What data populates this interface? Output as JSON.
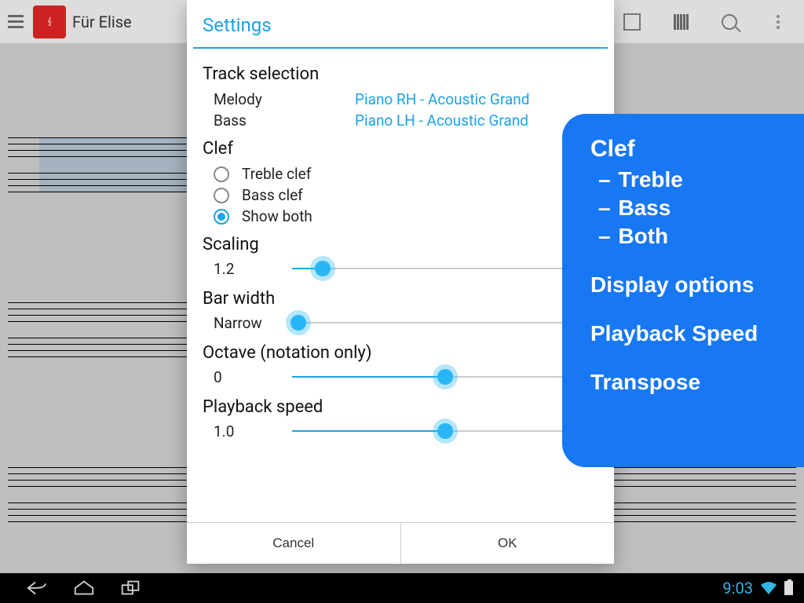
{
  "topbar": {
    "title": "Für Elise"
  },
  "dialog": {
    "title": "Settings",
    "track_selection": {
      "heading": "Track selection",
      "melody_label": "Melody",
      "melody_value": "Piano RH - Acoustic Grand",
      "bass_label": "Bass",
      "bass_value": "Piano LH - Acoustic Grand"
    },
    "clef": {
      "heading": "Clef",
      "treble": "Treble clef",
      "bass": "Bass clef",
      "both": "Show both",
      "selected": "both"
    },
    "scaling": {
      "heading": "Scaling",
      "value": "1.2",
      "pct": 10
    },
    "barwidth": {
      "heading": "Bar width",
      "value": "Narrow",
      "pct": 2
    },
    "octave": {
      "heading": "Octave (notation only)",
      "value": "0",
      "pct": 50
    },
    "speed": {
      "heading": "Playback speed",
      "value": "1.0",
      "pct": 50
    },
    "cancel": "Cancel",
    "ok": "OK"
  },
  "callout": {
    "clef": "Clef",
    "treble": "Treble",
    "bass": "Bass",
    "both": "Both",
    "display": "Display options",
    "speed": "Playback Speed",
    "transpose": "Transpose"
  },
  "statusbar": {
    "time": "9:03"
  }
}
